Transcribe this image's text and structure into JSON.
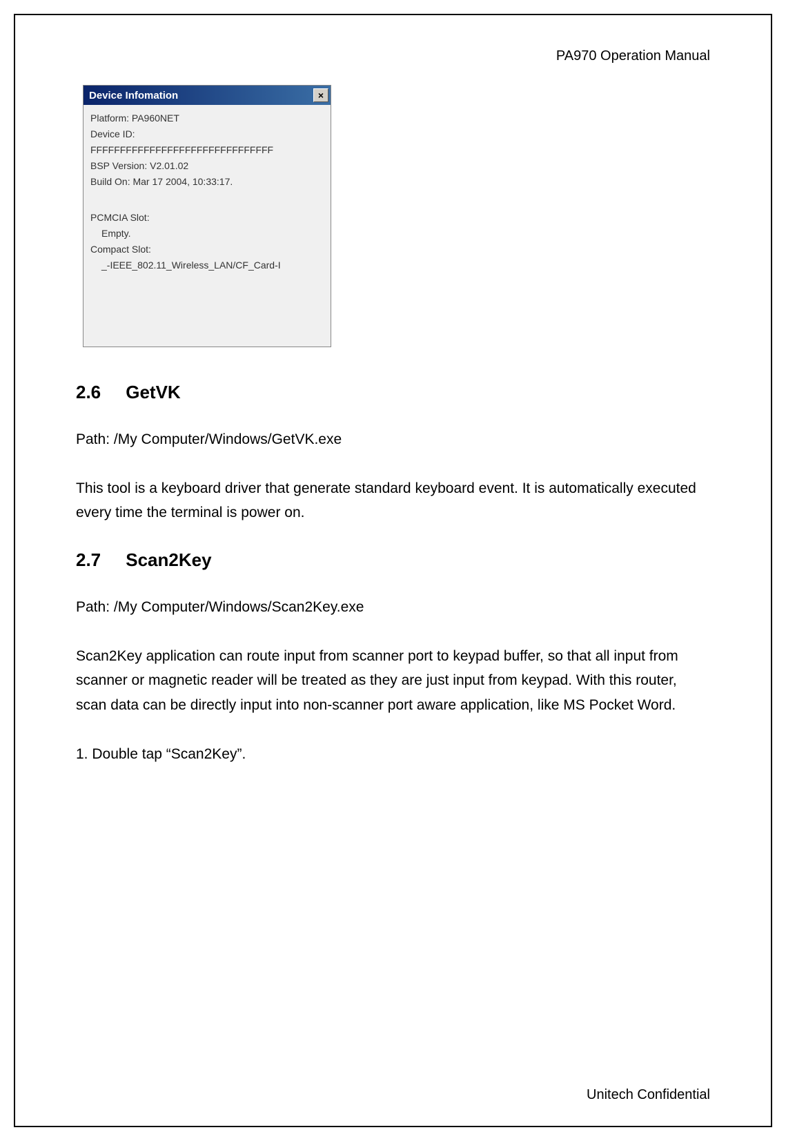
{
  "header": {
    "title": "PA970 Operation Manual"
  },
  "device_info_window": {
    "title": "Device Infomation",
    "close_label": "×",
    "platform_line": "Platform: PA960NET",
    "device_id_label": "Device ID:",
    "device_id_value": "FFFFFFFFFFFFFFFFFFFFFFFFFFFFFFF",
    "bsp_version": "BSP Version: V2.01.02",
    "build_on": "Build On: Mar 17 2004, 10:33:17.",
    "pcmcia_label": "PCMCIA Slot:",
    "pcmcia_value": "Empty.",
    "compact_label": "Compact Slot:",
    "compact_value": "_-IEEE_802.11_Wireless_LAN/CF_Card-I"
  },
  "sections": {
    "getvk": {
      "number": "2.6",
      "title": "GetVK",
      "path": "Path: /My Computer/Windows/GetVK.exe",
      "body": "This tool is a keyboard driver that generate standard keyboard event. It is automatically executed every time the terminal is power on."
    },
    "scan2key": {
      "number": "2.7",
      "title": "Scan2Key",
      "path": "Path: /My Computer/Windows/Scan2Key.exe",
      "body": "Scan2Key application can route input from scanner port to keypad buffer, so that all input from scanner or magnetic reader will be treated as they are just input from keypad. With this router, scan data can be directly input into non-scanner port aware application, like MS Pocket Word.",
      "step1": "1. Double tap “Scan2Key”."
    }
  },
  "footer": {
    "text": "Unitech Confidential"
  }
}
